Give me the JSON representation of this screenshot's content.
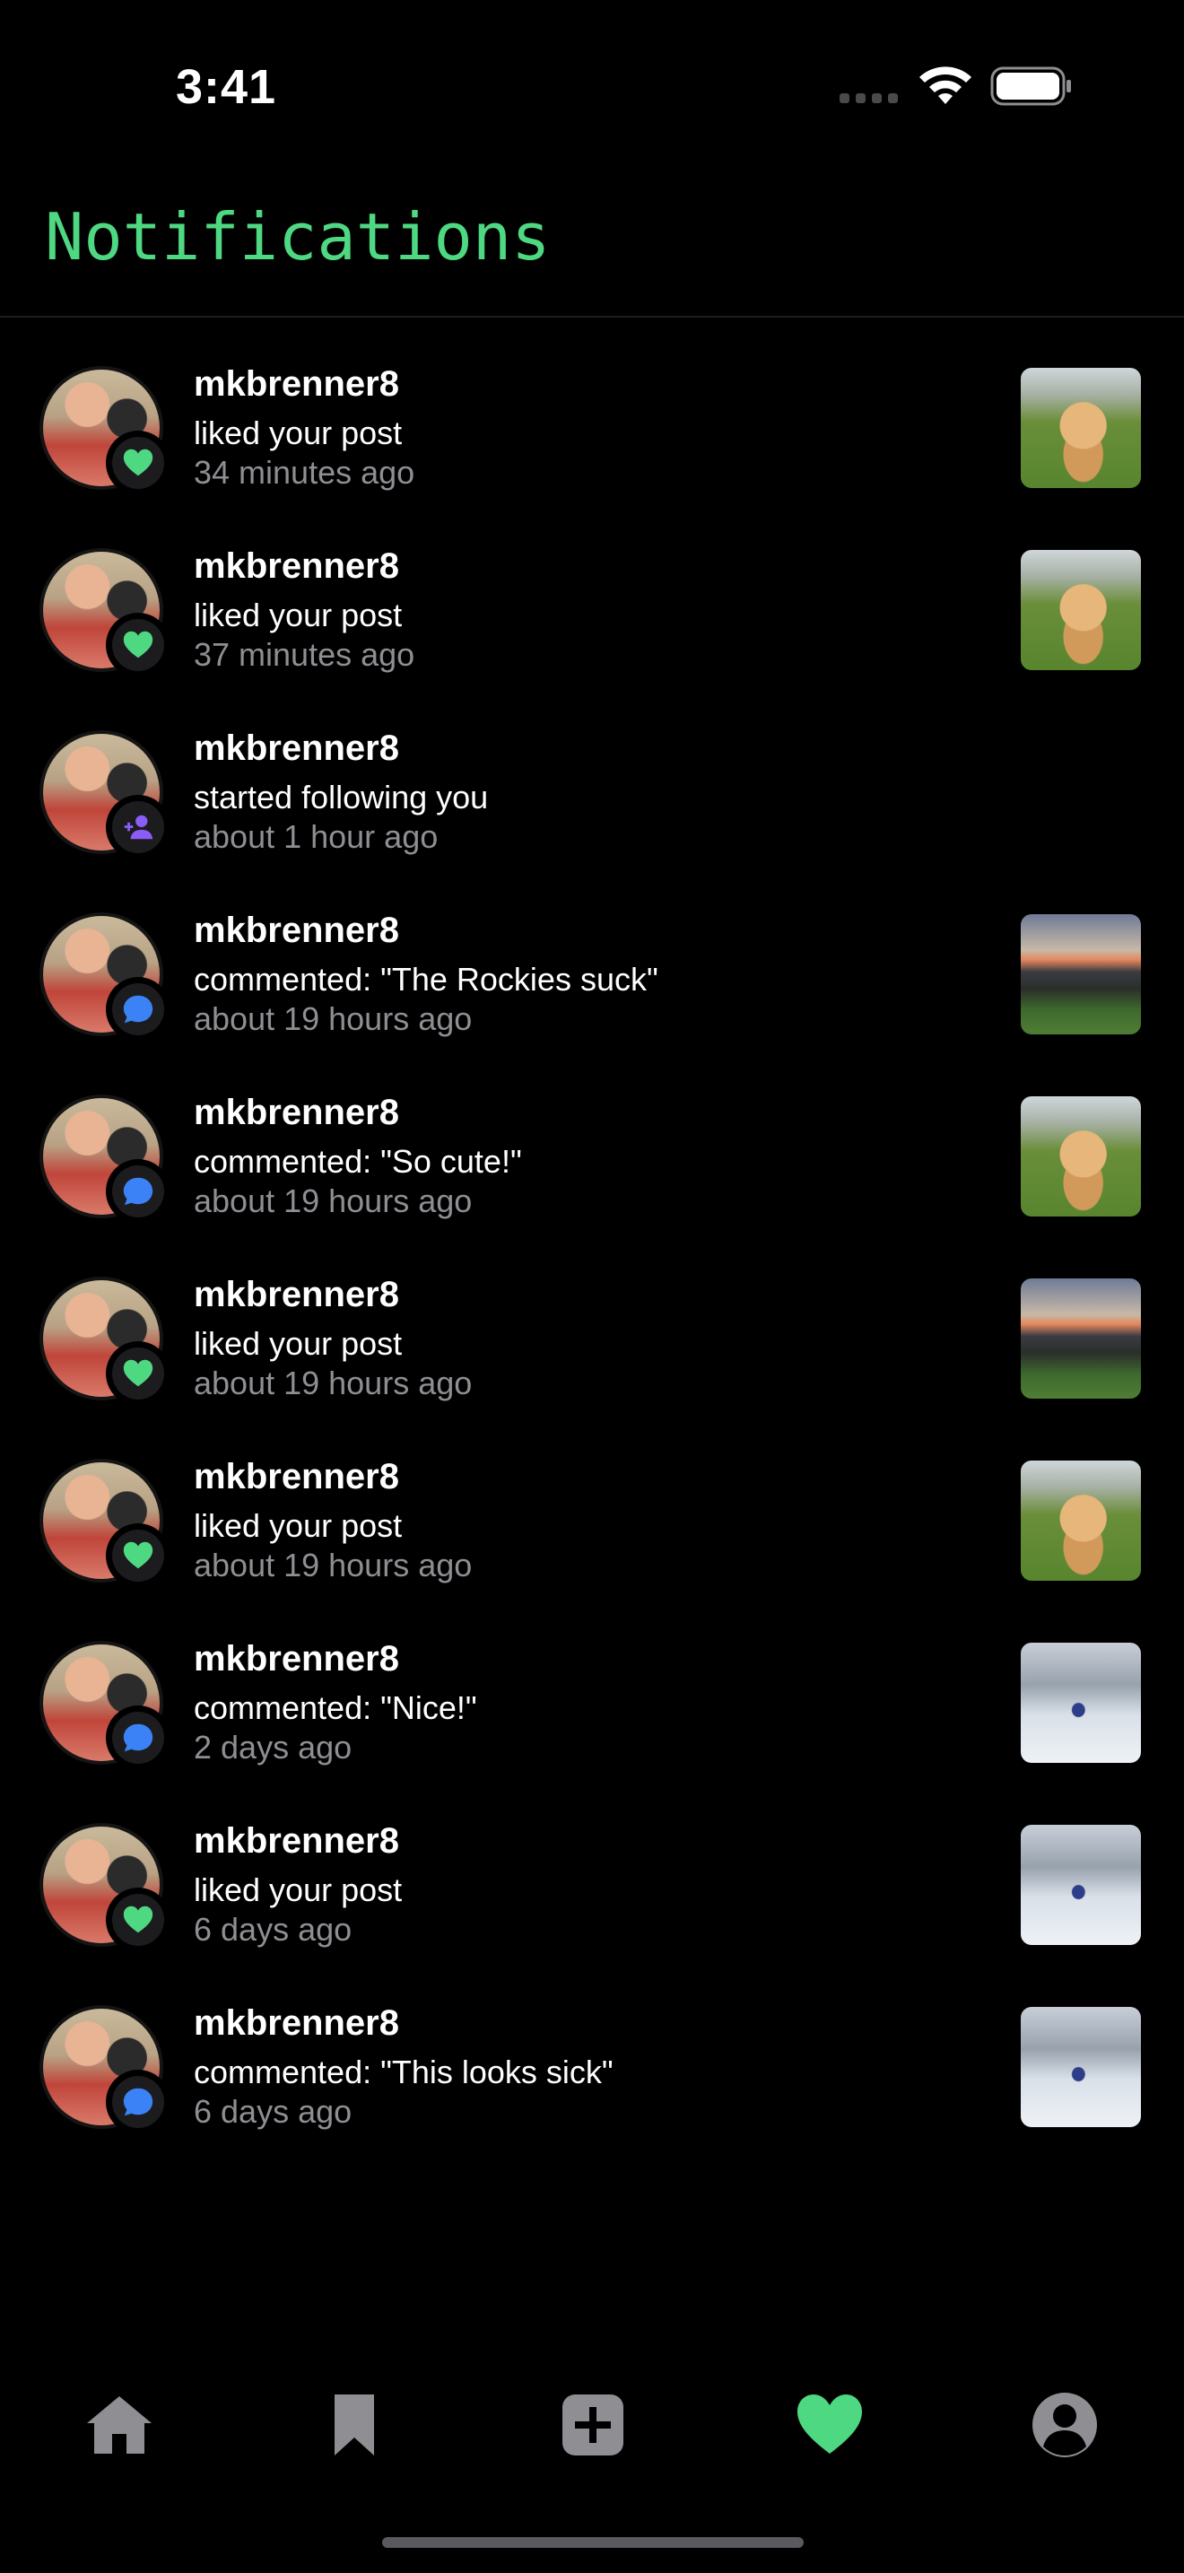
{
  "status_bar": {
    "time": "3:41"
  },
  "header": {
    "title": "Notifications"
  },
  "notifications": [
    {
      "username": "mkbrenner8",
      "action": "liked your post",
      "time_ago": "34 minutes ago",
      "type": "like",
      "thumbnail": "dog"
    },
    {
      "username": "mkbrenner8",
      "action": "liked your post",
      "time_ago": "37 minutes ago",
      "type": "like",
      "thumbnail": "dog"
    },
    {
      "username": "mkbrenner8",
      "action": "started following you",
      "time_ago": "about 1 hour ago",
      "type": "follow",
      "thumbnail": ""
    },
    {
      "username": "mkbrenner8",
      "action": "commented: \"The Rockies suck\"",
      "time_ago": "about 19 hours ago",
      "type": "comment",
      "thumbnail": "stadium"
    },
    {
      "username": "mkbrenner8",
      "action": "commented: \"So cute!\"",
      "time_ago": "about 19 hours ago",
      "type": "comment",
      "thumbnail": "dog"
    },
    {
      "username": "mkbrenner8",
      "action": "liked your post",
      "time_ago": "about 19 hours ago",
      "type": "like",
      "thumbnail": "stadium"
    },
    {
      "username": "mkbrenner8",
      "action": "liked your post",
      "time_ago": "about 19 hours ago",
      "type": "like",
      "thumbnail": "dog"
    },
    {
      "username": "mkbrenner8",
      "action": "commented: \"Nice!\"",
      "time_ago": "2 days ago",
      "type": "comment",
      "thumbnail": "snow"
    },
    {
      "username": "mkbrenner8",
      "action": "liked your post",
      "time_ago": "6 days ago",
      "type": "like",
      "thumbnail": "snow"
    },
    {
      "username": "mkbrenner8",
      "action": "commented: \"This looks sick\"",
      "time_ago": "6 days ago",
      "type": "comment",
      "thumbnail": "snow"
    }
  ],
  "tab_bar": {
    "tabs": [
      {
        "icon": "home-icon",
        "active": false
      },
      {
        "icon": "bookmark-icon",
        "active": false
      },
      {
        "icon": "add-post-icon",
        "active": false
      },
      {
        "icon": "heart-icon",
        "active": true
      },
      {
        "icon": "profile-icon",
        "active": false
      }
    ]
  },
  "colors": {
    "accent": "#4fd882",
    "like": "#4fd882",
    "comment": "#3b82f6",
    "follow": "#8b5cf6",
    "inactive_icon": "#8e8e93",
    "background": "#000000"
  }
}
